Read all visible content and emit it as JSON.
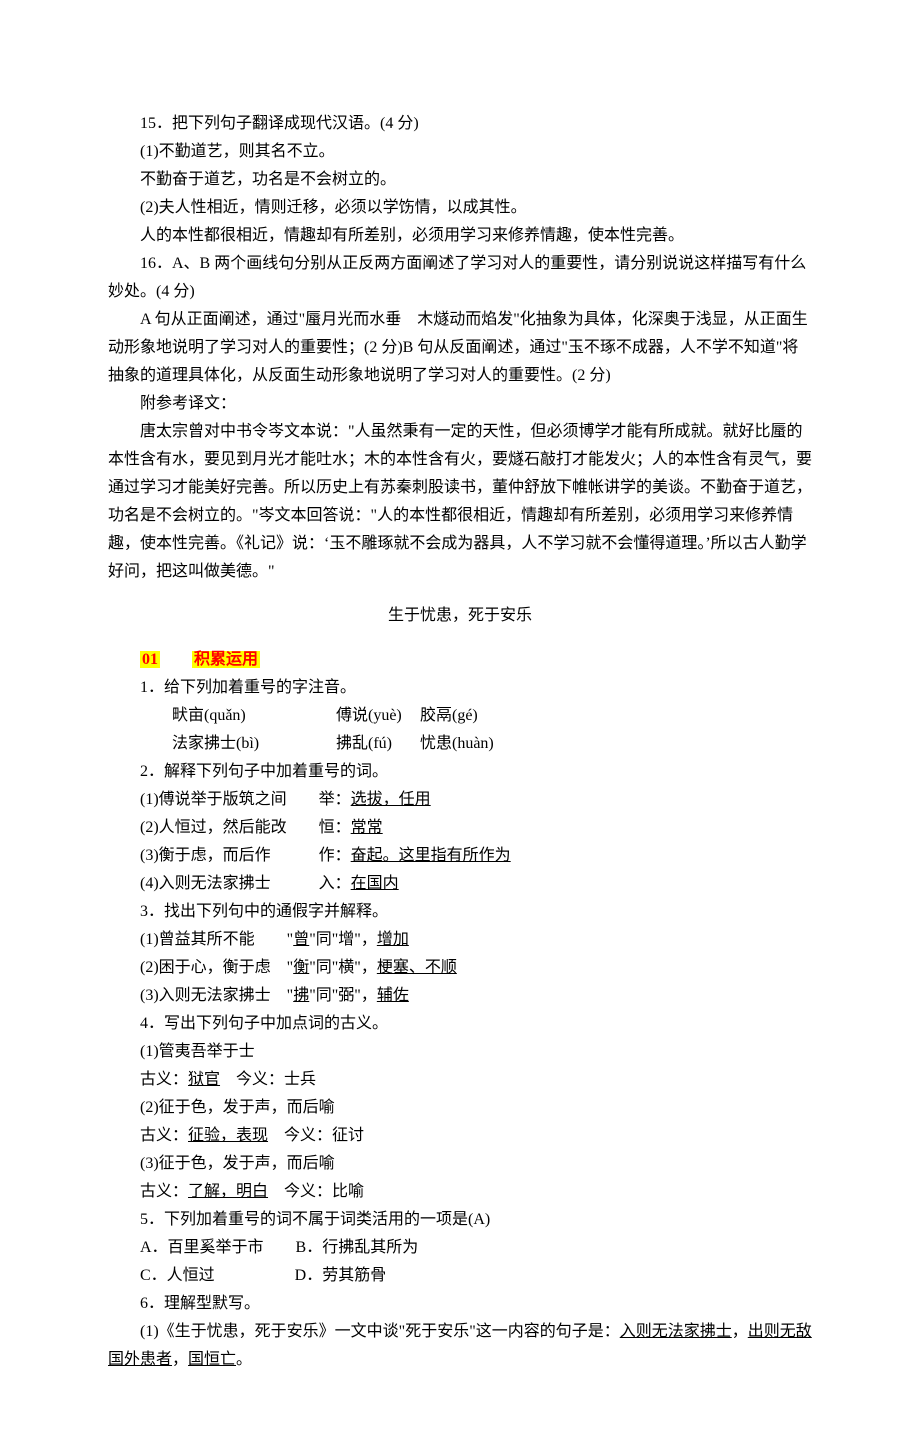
{
  "q15": {
    "title": "15．把下列句子翻译成现代汉语。(4 分)",
    "item1": "(1)不勤道艺，则其名不立。",
    "ans1": "不勤奋于道艺，功名是不会树立的。",
    "item2": "(2)夫人性相近，情则迁移，必须以学饬情，以成其性。",
    "ans2": "人的本性都很相近，情趣却有所差别，必须用学习来修养情趣，使本性完善。"
  },
  "q16": {
    "title": "16．A、B 两个画线句分别从正反两方面阐述了学习对人的重要性，请分别说说这样描写有什么妙处。(4 分)",
    "ans": "A 句从正面阐述，通过\"蜃月光而水垂　木燧动而焰发\"化抽象为具体，化深奥于浅显，从正面生动形象地说明了学习对人的重要性；(2 分)B 句从反面阐述，通过\"玉不琢不成器，人不学不知道\"将抽象的道理具体化，从反面生动形象地说明了学习对人的重要性。(2 分)"
  },
  "ref": {
    "head": "附参考译文：",
    "p1": "唐太宗曾对中书令岑文本说：\"人虽然秉有一定的天性，但必须博学才能有所成就。就好比蜃的本性含有水，要见到月光才能吐水；木的本性含有火，要燧石敲打才能发火；人的本性含有灵气，要通过学习才能美好完善。所以历史上有苏秦刺股读书，董仲舒放下帷帐讲学的美谈。不勤奋于道艺，功名是不会树立的。\"岑文本回答说：\"人的本性都很相近，情趣却有所差别，必须用学习来修养情趣，使本性完善。《礼记》说：‘玉不雕琢就不会成为器具，人不学习就不会懂得道理。’所以古人勤学好问，把这叫做美德。\""
  },
  "title2": "生于忧患，死于安乐",
  "section": {
    "num": "01",
    "label": "积累运用"
  },
  "s1": {
    "q": "1．给下列加着重号的字注音。",
    "row1a": "畎亩(quǎn)",
    "row1b": "傅说(yuè)",
    "row1c": "胶鬲(gé)",
    "row2a": "法家拂士(bì)",
    "row2b": "拂乱(fú)",
    "row2c": "忧患(huàn)"
  },
  "s2": {
    "q": "2．解释下列句子中加着重号的词。",
    "i1a": "(1)傅说举于版筑之间　　举：",
    "i1b": "选拔，任用",
    "i2a": "(2)人恒过，然后能改　　恒：",
    "i2b": "常常",
    "i3a": "(3)衡于虑，而后作　　　作：",
    "i3b": "奋起。这里指有所作为",
    "i4a": "(4)入则无法家拂士　　　入：",
    "i4b": "在国内"
  },
  "s3": {
    "q": "3．找出下列句中的通假字并解释。",
    "i1a": "(1)曾益其所不能　　\"",
    "i1b": "曾",
    "i1c": "\"同\"增\"，",
    "i1d": "增加",
    "i2a": "(2)困于心，衡于虑　\"",
    "i2b": "衡",
    "i2c": "\"同\"横\"，",
    "i2d": "梗塞、不顺",
    "i3a": "(3)入则无法家拂士　\"",
    "i3b": "拂",
    "i3c": "\"同\"弼\"，",
    "i3d": "辅佐"
  },
  "s4": {
    "q": "4．写出下列句子中加点词的古义。",
    "i1": "(1)管夷吾举于士",
    "i1a": "古义：",
    "i1b": "狱官",
    "i1c": "　今义：士兵",
    "i2": "(2)征于色，发于声，而后喻",
    "i2a": "古义：",
    "i2b": "征验，表现",
    "i2c": "　今义：征讨",
    "i3": "(3)征于色，发于声，而后喻",
    "i3a": "古义：",
    "i3b": "了解，明白",
    "i3c": "　今义：比喻"
  },
  "s5": {
    "q": "5．下列加着重号的词不属于词类活用的一项是(A)",
    "a": "A．百里奚举于市　　B．行拂乱其所为",
    "b": "C．人恒过　　　　　D．劳其筋骨"
  },
  "s6": {
    "q": "6．理解型默写。",
    "i1a": "(1)《生于忧患，死于安乐》一文中谈\"死于安乐\"这一内容的句子是：",
    "i1b": "入则无法家拂士",
    "i1c": "，",
    "i1d": "出则无敌国外患者",
    "i1e": "，",
    "i1f": "国恒亡",
    "i1g": "。"
  }
}
